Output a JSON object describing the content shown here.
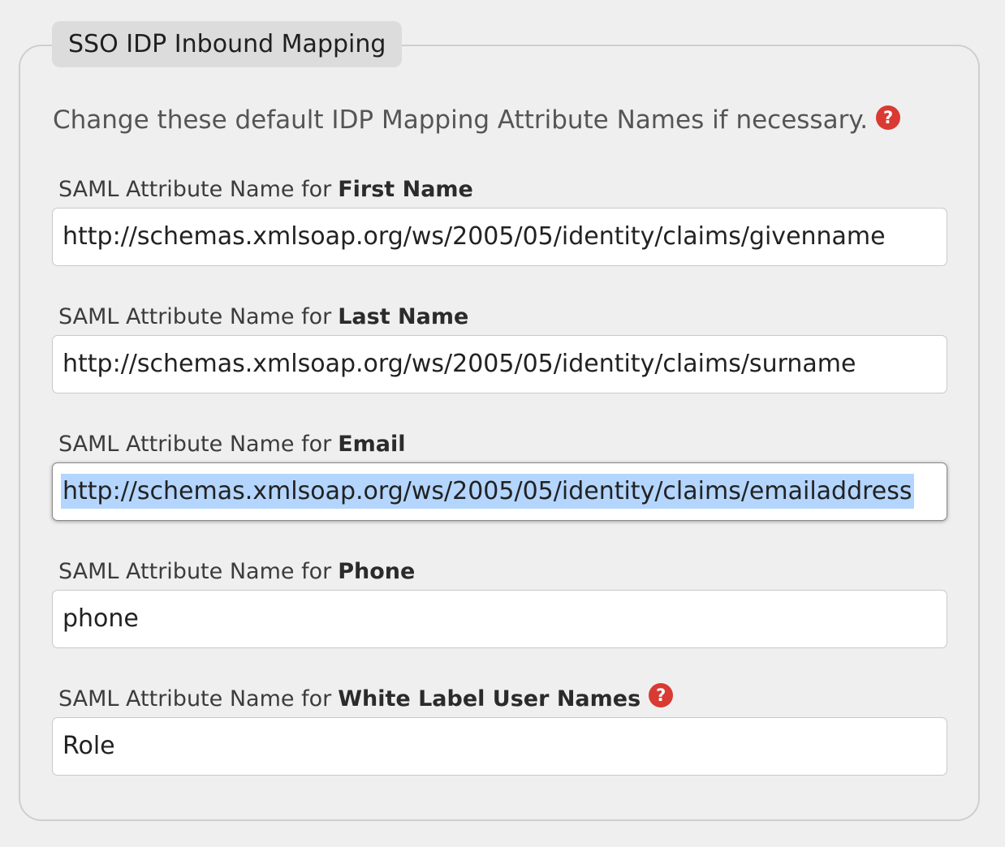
{
  "section": {
    "title": "SSO IDP Inbound Mapping",
    "intro": "Change these default IDP Mapping Attribute Names if necessary.",
    "help_icon": "?"
  },
  "fields": [
    {
      "label_prefix": "SAML Attribute Name for",
      "label_bold": "First Name",
      "value": "http://schemas.xmlsoap.org/ws/2005/05/identity/claims/givenname"
    },
    {
      "label_prefix": "SAML Attribute Name for",
      "label_bold": "Last Name",
      "value": "http://schemas.xmlsoap.org/ws/2005/05/identity/claims/surname"
    },
    {
      "label_prefix": "SAML Attribute Name for",
      "label_bold": "Email",
      "value": "http://schemas.xmlsoap.org/ws/2005/05/identity/claims/emailaddress",
      "focused": true,
      "text_selected": true
    },
    {
      "label_prefix": "SAML Attribute Name for",
      "label_bold": "Phone",
      "value": "phone"
    },
    {
      "label_prefix": "SAML Attribute Name for",
      "label_bold": "White Label User Names",
      "value": "Role",
      "help_icon": "?"
    }
  ],
  "colors": {
    "page_background": "#efefef",
    "legend_background": "#dcdcdc",
    "help_icon": "#d93a32",
    "selection_highlight": "#b4d5fe"
  }
}
